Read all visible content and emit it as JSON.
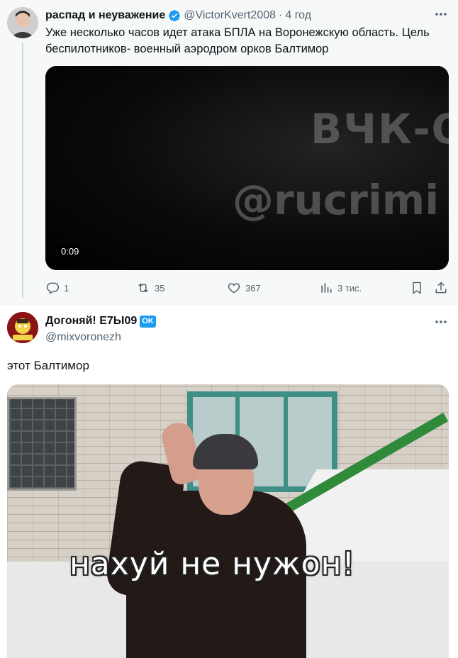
{
  "tweet1": {
    "display_name": "распад и неуважение",
    "handle": "@VictorKvert2008",
    "time": "4 год",
    "text": "Уже несколько часов идет атака БПЛА на Воронежскую область. Цель беспилотников- военный аэродром орков Балтимор",
    "video": {
      "watermark_line1": "ВЧК-О",
      "watermark_line2": "@rucrimi",
      "duration": "0:09"
    },
    "actions": {
      "replies": "1",
      "retweets": "35",
      "likes": "367",
      "views": "3 тис."
    },
    "icons": [
      "verified-icon",
      "more-icon",
      "reply-icon",
      "retweet-icon",
      "like-icon",
      "views-icon",
      "bookmark-icon",
      "share-icon"
    ]
  },
  "tweet2": {
    "display_name": "Догоняй! E7Ы09",
    "badge": "OK",
    "handle": "@mixvoronezh",
    "text": "этот Балтимор",
    "image_caption": "нахуй не нужон!"
  },
  "colors": {
    "accent": "#1d9bf0",
    "muted_text": "#536471",
    "quoted_background": "#f7f9f9"
  }
}
